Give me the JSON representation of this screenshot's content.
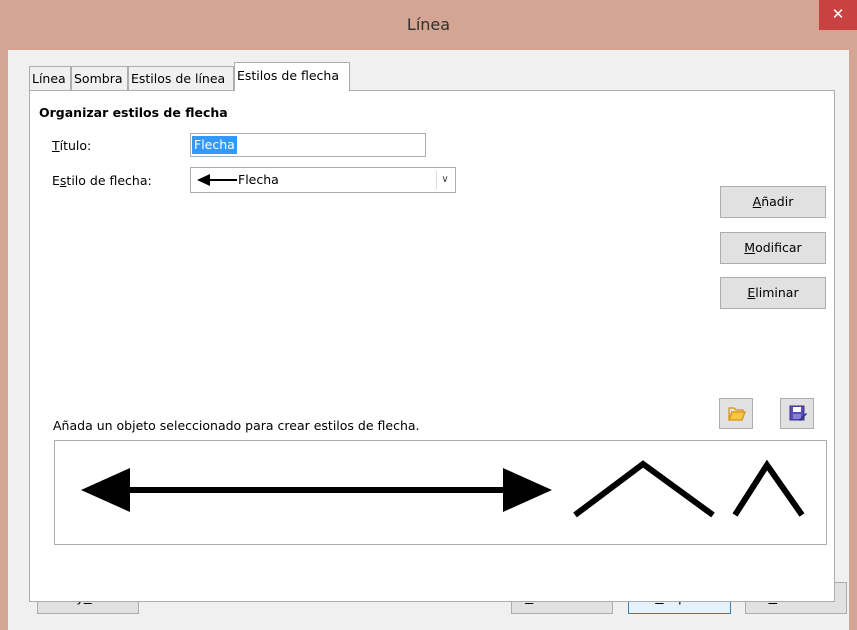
{
  "window": {
    "title": "Línea",
    "close_glyph": "✕"
  },
  "tabs": [
    {
      "label": "Línea",
      "active": false
    },
    {
      "label": "Sombra",
      "active": false
    },
    {
      "label": "Estilos de línea",
      "active": false
    },
    {
      "label": "Estilos de flecha",
      "active": true
    }
  ],
  "panel": {
    "section_title": "Organizar estilos de flecha",
    "title_label": "Título:",
    "title_value": "Flecha",
    "style_label": "Estilo de flecha:",
    "style_value": "Flecha",
    "hint": "Añada un objeto seleccionado para crear estilos de flecha."
  },
  "side_buttons": {
    "add": "Añadir",
    "modify": "Modificar",
    "delete": "Eliminar"
  },
  "icons": {
    "open": "folder-open-icon",
    "save": "save-icon",
    "folder_color": "#f5b731",
    "save_color": "#4b3fa6"
  },
  "footer": {
    "help": "Ayuda",
    "reset": "Restablecer",
    "ok": "Aceptar",
    "cancel": "Cancelar"
  }
}
